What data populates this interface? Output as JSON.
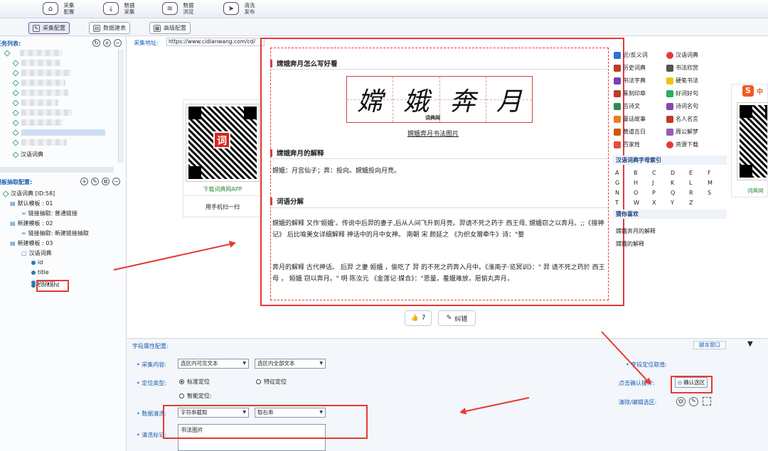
{
  "toolbar": {
    "items": [
      {
        "label": "采集\n配置",
        "icon": "home-icon"
      },
      {
        "label": "数据\n采集",
        "icon": "download-icon"
      },
      {
        "label": "数据\n浏览",
        "icon": "layers-icon"
      },
      {
        "label": "清洗\n发布",
        "icon": "paper-plane-icon"
      }
    ]
  },
  "tabs": [
    {
      "label": "采集配置",
      "active": true
    },
    {
      "label": "数据建表",
      "active": false
    },
    {
      "label": "高级配置",
      "active": false
    }
  ],
  "left": {
    "task_list_title": "任务列表:",
    "task_last_item": "汉语词典",
    "template_title": "模板抽取配置:",
    "tree": [
      {
        "label": "汉语词典 [ID:58]",
        "level": 0
      },
      {
        "label": "默认模板 : 01",
        "level": 1
      },
      {
        "label": "链接抽取: 普通链接",
        "level": 2
      },
      {
        "label": "新建模板 : 02",
        "level": 1
      },
      {
        "label": "链接抽取: 新建链接抽取",
        "level": 2
      },
      {
        "label": "新建模板 : 03",
        "level": 1
      },
      {
        "label": "汉语词典",
        "level": 2
      },
      {
        "label": "id",
        "level": 3
      },
      {
        "label": "title",
        "level": 3
      },
      {
        "label": "pinyin",
        "level": 3
      },
      {
        "label": "content",
        "level": 3
      }
    ]
  },
  "address": {
    "label": "采集地址:",
    "value": "https://www.cidianwang.com/cd/"
  },
  "qr_left": {
    "center_char": "词",
    "caption1": "下载词典网APP",
    "caption2": "用手机扫一扫"
  },
  "article": {
    "section1_title": "嫦娥奔月怎么写好看",
    "calligraphy": [
      "嫦",
      "娥",
      "奔",
      "月"
    ],
    "calligraphy_watermark": "词典网",
    "image_caption": "嫦娥奔月书法图片",
    "section2_title": "嫦娥奔月的解释",
    "section2_text": "嫦娥：月宫仙子；奔：投向。嫦娥投向月亮。",
    "section3_title": "词语分解",
    "para1": "嫦娥的解释 又作'姮娥'。传说中后羿的妻子,后从人间飞升到月亮。羿请不死之药于 西王母, 嫦娥窃之以奔月。;;《搜神记》 后比喻美女详细解释 神话中的月中女神。 南朝 宋 颜延之 《为织女赠牵牛》诗：\"婺",
    "para2": "奔月的解释 古代神话。 后羿 之妻 姮娥 ，偷吃了 羿 的不死之药奔入月中。《淮南子·览冥训》：\" 羿 请不死之药於 西王母 ， 姮娥 窃以奔月。\" 明 陈汝元 《金莲记·媒合》：\"思量，羞娥难放，愿偷丸奔月，"
  },
  "actions": {
    "like_count": "7",
    "correct_label": "纠错"
  },
  "right_sidebar": {
    "links_col1": [
      "近/反义词",
      "历史词典",
      "书法字典",
      "篆刻印章",
      "古诗文",
      "童话故事",
      "黄道吉日",
      "百家姓"
    ],
    "links_col2": [
      "汉语词典",
      "书法欣赏",
      "硬笔书法",
      "好词好句",
      "诗词名句",
      "名人名言",
      "周公解梦",
      "资源下载"
    ],
    "index_title": "汉语词典字母索引",
    "letters": [
      "A",
      "B",
      "C",
      "D",
      "E",
      "F",
      "G",
      "H",
      "J",
      "K",
      "L",
      "M",
      "N",
      "O",
      "P",
      "Q",
      "R",
      "S",
      "T",
      "W",
      "X",
      "Y",
      "Z"
    ],
    "guess_title": "猜你喜欢",
    "guess_items": [
      "嫦娥奔月的解释",
      "嫦娥的解释"
    ],
    "far_right_caption": "词典网"
  },
  "bottom": {
    "title": "字段属性配置:",
    "script_window": "脚本窗口",
    "collect_label": "采集内容:",
    "collect_opt1": "选区内可见文本",
    "collect_opt2": "选区内全部文本",
    "locate_label": "定位类型:",
    "locate_std": "标准定位",
    "locate_feat": "特征定位",
    "locate_smart": "智能定位:",
    "clean_label": "数据清洗:",
    "clean_opt1": "字符串截取",
    "clean_opt2": "取右串",
    "marker_label": "清洗标记:",
    "marker_value": "书法图片",
    "field_value_label": "字段定位取值:",
    "confirm_label": "点击确认操作:",
    "confirm_button": "确认选区",
    "clear_label": "清除/编辑选区:"
  }
}
